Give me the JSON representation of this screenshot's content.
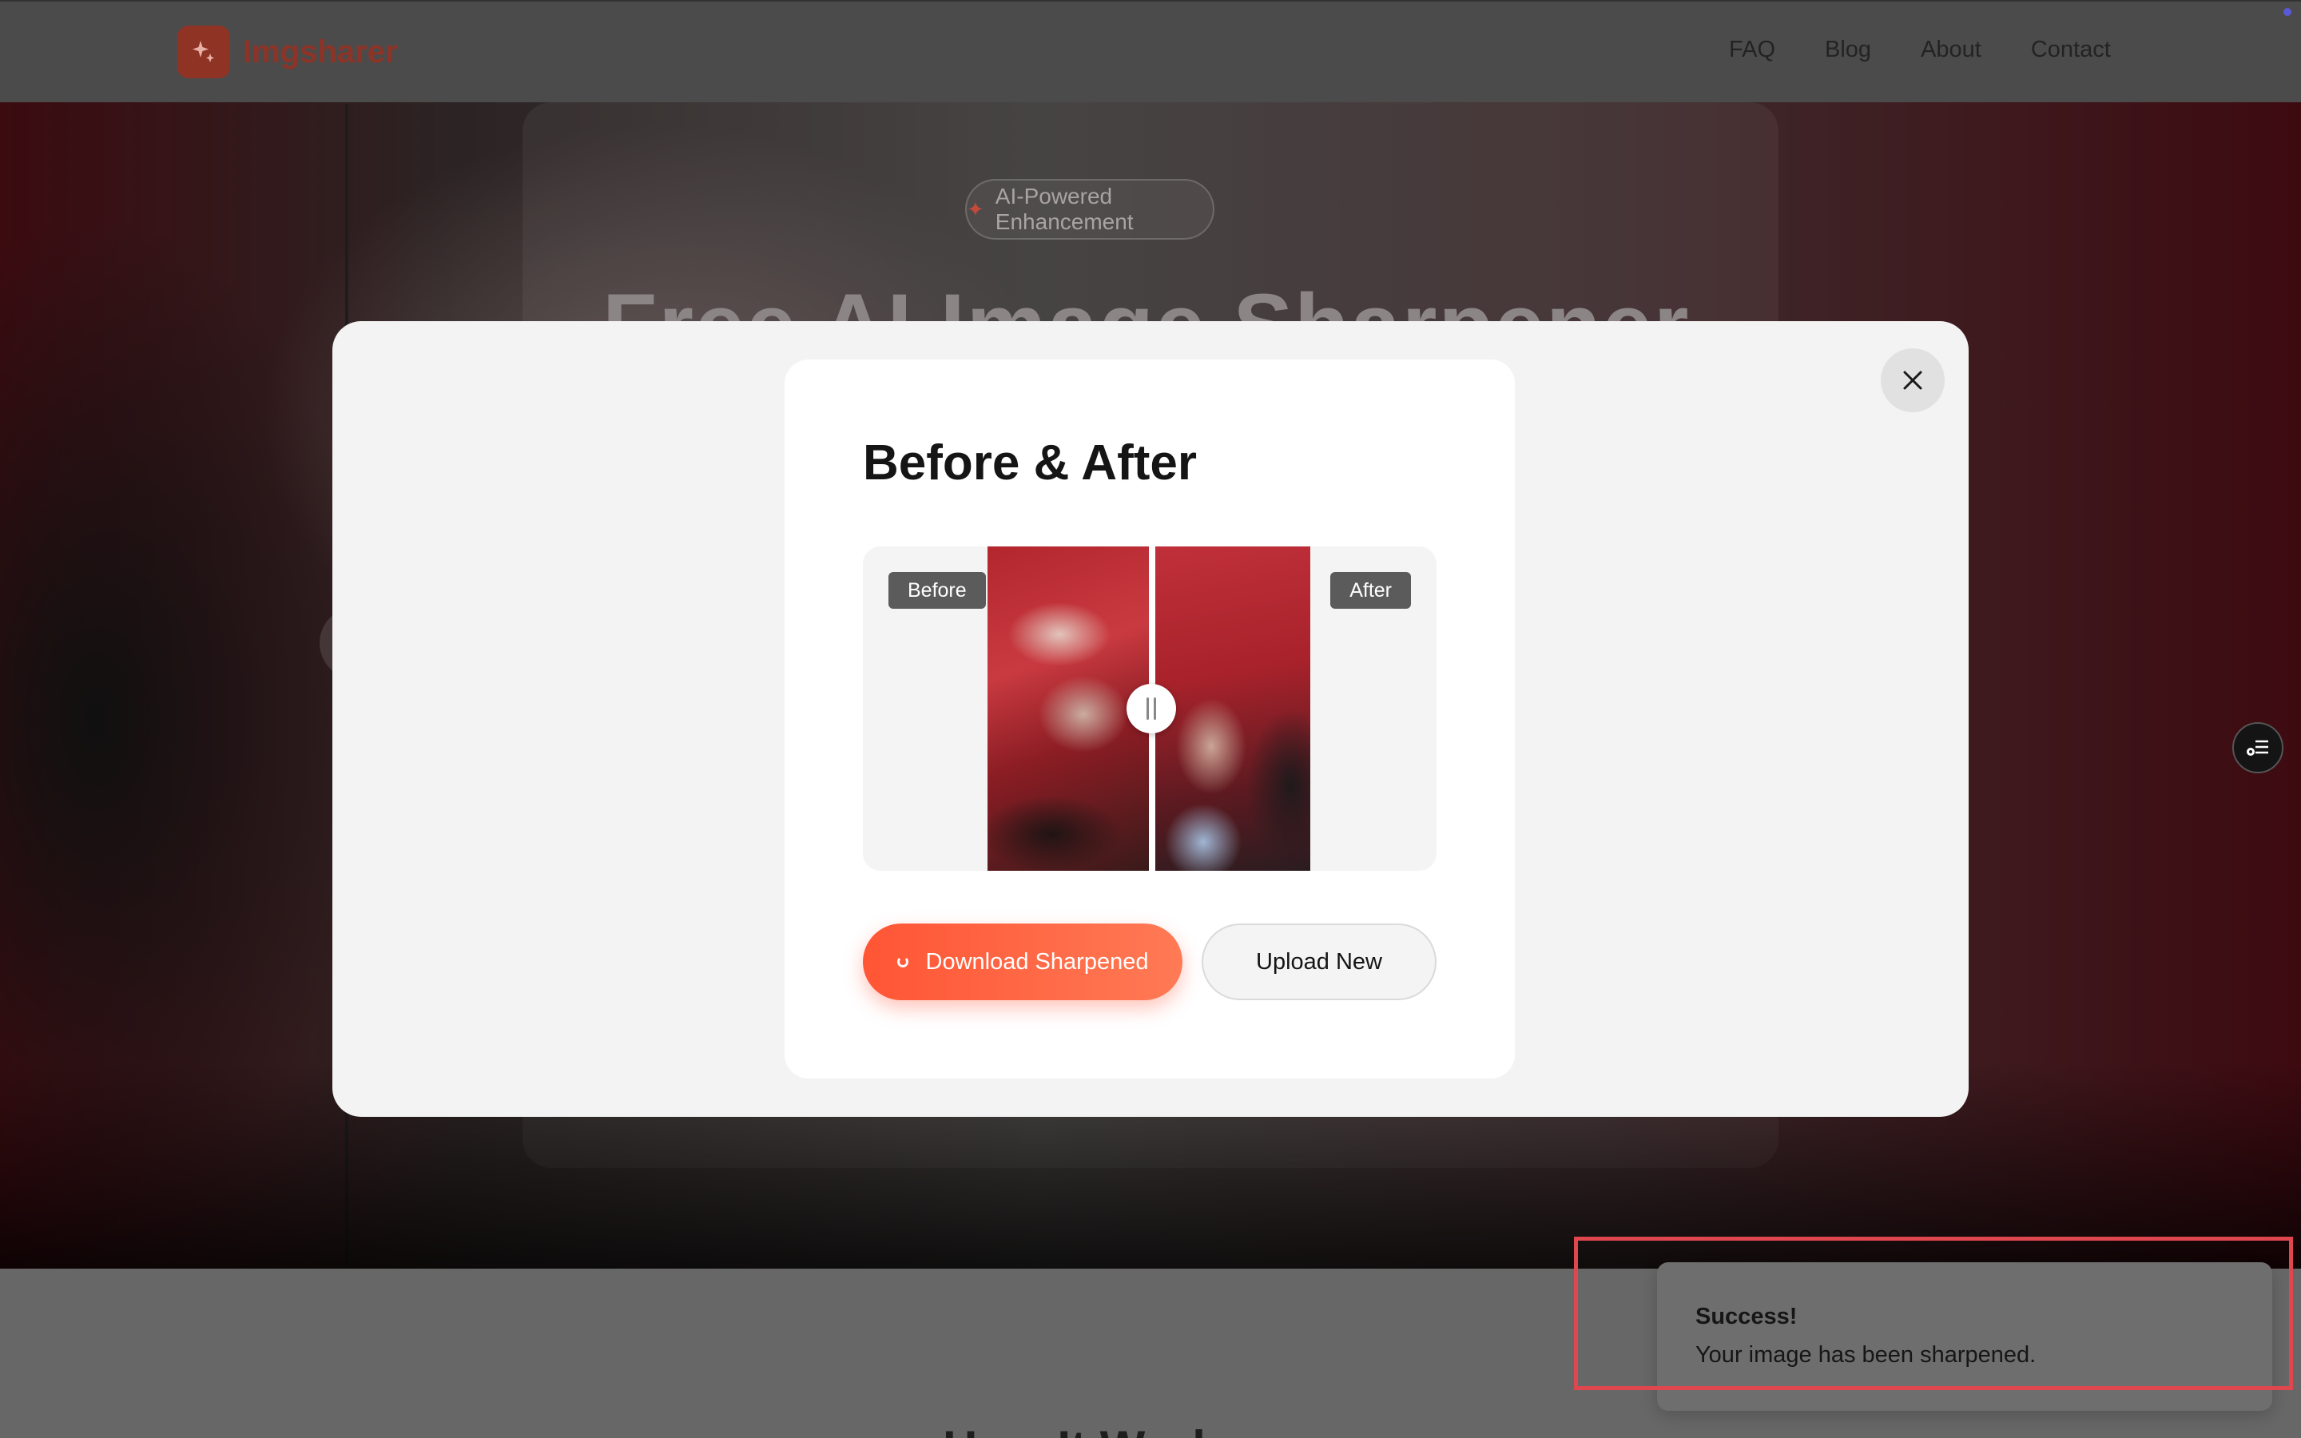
{
  "nav": {
    "brand": "Imgsharer",
    "links": [
      "FAQ",
      "Blog",
      "About",
      "Contact"
    ]
  },
  "hero": {
    "badge": "AI-Powered Enhancement",
    "title": "Free AI Image Sharpener"
  },
  "section": {
    "heading": "How It Works"
  },
  "modal": {
    "title": "Before & After",
    "before_label": "Before",
    "after_label": "After",
    "download_label": "Download Sharpened",
    "upload_label": "Upload New"
  },
  "toast": {
    "title": "Success!",
    "message": "Your image has been sharpened."
  },
  "colors": {
    "accent": "#ff5a3c",
    "toast_highlight": "#e0464e",
    "tag_bg": "#5b5b5b"
  },
  "icons": {
    "logo": "sparkle-icon",
    "close": "close-icon",
    "badge": "sparkle-icon",
    "side_widget": "list-settings-icon",
    "download_state": "spinner-icon"
  }
}
